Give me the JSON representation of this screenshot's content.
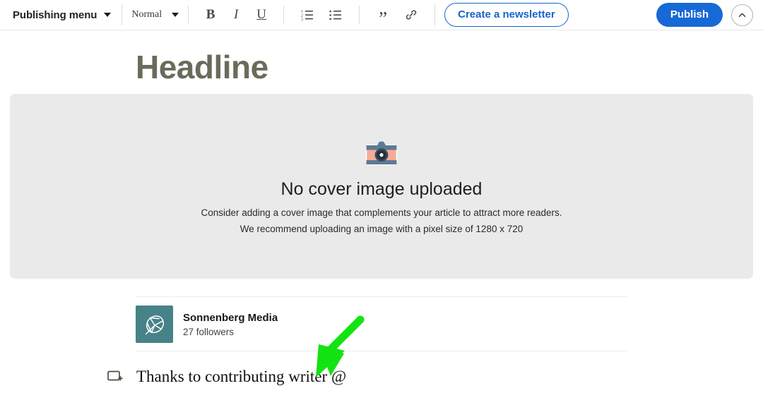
{
  "toolbar": {
    "publishing_menu_label": "Publishing menu",
    "publishing_menu_caret": "chevron-down-icon",
    "style_select_value": "Normal",
    "style_select_caret": "chevron-down-icon",
    "bold_label": "B",
    "italic_label": "I",
    "underline_label": "U",
    "ordered_list_icon": "ordered-list-icon",
    "bulleted_list_icon": "bulleted-list-icon",
    "quote_label": "”",
    "link_icon": "link-icon",
    "newsletter_button_label": "Create a newsletter",
    "publish_button_label": "Publish",
    "collapse_button_icon": "chevron-up-icon",
    "accent_blue": "#1769d6",
    "newsletter_border_blue": "#1a66c9"
  },
  "editor": {
    "headline_placeholder": "Headline",
    "cover": {
      "icon": "camera-icon",
      "title": "No cover image uploaded",
      "subtitle_line1": "Consider adding a cover image that complements your article to attract more readers.",
      "subtitle_line2": "We recommend uploading an image with a pixel size of 1280 x 720",
      "background": "#eaeaea"
    },
    "author": {
      "avatar_icon": "leaf-logo-icon",
      "avatar_color": "#468287",
      "name": "Sonnenberg Media",
      "followers": "27 followers"
    },
    "body": {
      "add_block_icon": "add-block-icon",
      "text": "Thanks to contributing writer @"
    }
  },
  "annotation": {
    "arrow_icon": "arrow-down-left-icon",
    "arrow_color": "#13e313"
  }
}
